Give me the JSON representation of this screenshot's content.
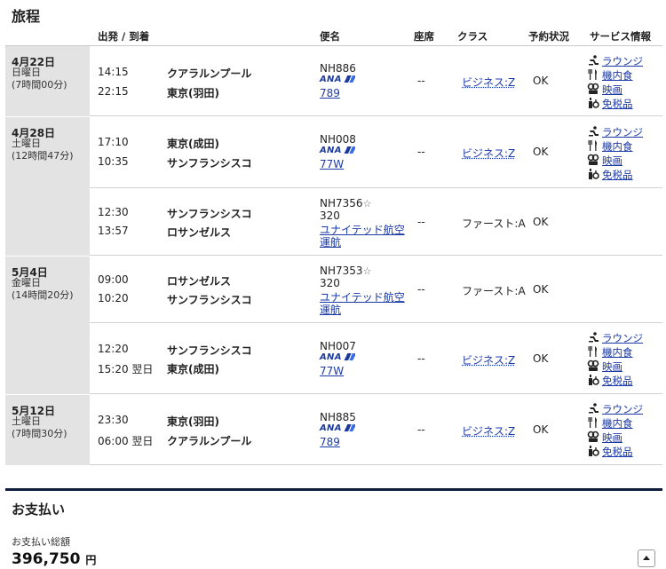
{
  "itinerary": {
    "title": "旅程",
    "headers": {
      "route": "出発 / 到着",
      "flight": "便名",
      "seat": "座席",
      "class": "クラス",
      "booking": "予約状況",
      "services": "サービス情報"
    },
    "dates": [
      {
        "date": "4月22日",
        "weekday": "日曜日",
        "duration": "(7時間00分)"
      },
      {
        "date": "4月28日",
        "weekday": "土曜日",
        "duration": "(12時間47分)"
      },
      {
        "date": "5月4日",
        "weekday": "金曜日",
        "duration": "(14時間20分)"
      },
      {
        "date": "5月12日",
        "weekday": "土曜日",
        "duration": "(7時間30分)"
      }
    ],
    "segments": [
      {
        "dep_time": "14:15",
        "dep_city": "クアラルンプール",
        "arr_time": "22:15",
        "arr_city": "東京(羽田)",
        "flight_no": "NH886",
        "carrier": "ANA",
        "aircraft": "789",
        "seat": "--",
        "cabin": "ビジネス:Z",
        "status": "OK"
      },
      {
        "dep_time": "17:10",
        "dep_city": "東京(成田)",
        "arr_time": "10:35",
        "arr_city": "サンフランシスコ",
        "flight_no": "NH008",
        "carrier": "ANA",
        "aircraft": "77W",
        "seat": "--",
        "cabin": "ビジネス:Z",
        "status": "OK"
      },
      {
        "dep_time": "12:30",
        "dep_city": "サンフランシスコ",
        "arr_time": "13:57",
        "arr_city": "ロサンゼルス",
        "flight_no": "NH7356",
        "codeshare_mark": "☆",
        "aircraft": "320",
        "operator_line1": "ユナイテッド航空",
        "operator_line2": "運航",
        "seat": "--",
        "cabin": "ファースト:A",
        "status": "OK"
      },
      {
        "dep_time": "09:00",
        "dep_city": "ロサンゼルス",
        "arr_time": "10:20",
        "arr_city": "サンフランシスコ",
        "flight_no": "NH7353",
        "codeshare_mark": "☆",
        "aircraft": "320",
        "operator_line1": "ユナイテッド航空",
        "operator_line2": "運航",
        "seat": "--",
        "cabin": "ファースト:A",
        "status": "OK"
      },
      {
        "dep_time": "12:20",
        "dep_city": "サンフランシスコ",
        "arr_time": "15:20 翌日",
        "arr_city": "東京(成田)",
        "flight_no": "NH007",
        "carrier": "ANA",
        "aircraft": "77W",
        "seat": "--",
        "cabin": "ビジネス:Z",
        "status": "OK"
      },
      {
        "dep_time": "23:30",
        "dep_city": "東京(羽田)",
        "arr_time": "06:00 翌日",
        "arr_city": "クアラルンプール",
        "flight_no": "NH885",
        "carrier": "ANA",
        "aircraft": "789",
        "seat": "--",
        "cabin": "ビジネス:Z",
        "status": "OK"
      }
    ],
    "services": {
      "lounge": "ラウンジ",
      "meal": "機内食",
      "movie": "映画",
      "dutyfree": "免税品"
    }
  },
  "payment": {
    "title": "お支払い",
    "total_label": "お支払い総額",
    "total_amount": "396,750",
    "currency_unit": "円"
  },
  "colors": {
    "link": "#1b3aa8",
    "date_column_bg": "#e3e3e3",
    "section_rule": "#0e1c3d",
    "ana_blue": "#1a3aa0"
  }
}
